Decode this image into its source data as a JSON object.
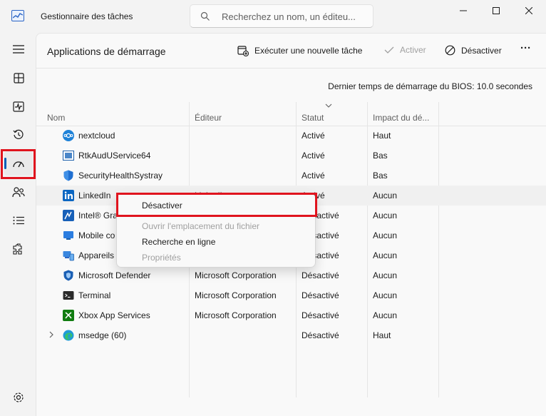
{
  "window": {
    "title": "Gestionnaire des tâches",
    "search_placeholder": "Recherchez un nom, un éditeu..."
  },
  "sidebar": {
    "items": [
      {
        "icon": "hamburger-icon"
      },
      {
        "icon": "processes-icon"
      },
      {
        "icon": "performance-icon"
      },
      {
        "icon": "app-history-icon"
      },
      {
        "icon": "startup-apps-icon",
        "active": true
      },
      {
        "icon": "users-icon"
      },
      {
        "icon": "details-icon"
      },
      {
        "icon": "services-icon"
      },
      {
        "icon": "settings-icon"
      }
    ]
  },
  "header": {
    "page_title": "Applications de démarrage",
    "run_task": "Exécuter une nouvelle tâche",
    "enable": "Activer",
    "disable": "Désactiver",
    "more": "···"
  },
  "bios_time": "Dernier temps de démarrage du BIOS: 10.0 secondes",
  "table": {
    "columns": [
      "Nom",
      "Éditeur",
      "Statut",
      "Impact du dé..."
    ],
    "rows": [
      {
        "name": "nextcloud",
        "publisher": "",
        "status": "Activé",
        "impact": "Haut",
        "icon": "nextcloud-icon"
      },
      {
        "name": "RtkAudUService64",
        "publisher": "",
        "status": "Activé",
        "impact": "Bas",
        "icon": "realtek-icon"
      },
      {
        "name": "SecurityHealthSystray",
        "publisher": "",
        "status": "Activé",
        "impact": "Bas",
        "icon": "shield-icon"
      },
      {
        "name": "LinkedIn",
        "publisher": "LinkedIn",
        "status": "Activé",
        "impact": "Aucun",
        "icon": "linkedin-icon"
      },
      {
        "name": "Intel® Gra",
        "publisher": "",
        "status": "Désactivé",
        "impact": "Aucun",
        "icon": "intel-graphics-icon"
      },
      {
        "name": "Mobile co",
        "publisher": "",
        "status": "Désactivé",
        "impact": "Aucun",
        "icon": "phone-link-icon"
      },
      {
        "name": "Appareils",
        "publisher": "",
        "status": "Désactivé",
        "impact": "Aucun",
        "icon": "devices-icon"
      },
      {
        "name": "Microsoft Defender",
        "publisher": "Microsoft Corporation",
        "status": "Désactivé",
        "impact": "Aucun",
        "icon": "defender-icon"
      },
      {
        "name": "Terminal",
        "publisher": "Microsoft Corporation",
        "status": "Désactivé",
        "impact": "Aucun",
        "icon": "terminal-icon"
      },
      {
        "name": "Xbox App Services",
        "publisher": "Microsoft Corporation",
        "status": "Désactivé",
        "impact": "Aucun",
        "icon": "xbox-icon"
      },
      {
        "name": "msedge (60)",
        "publisher": "",
        "status": "Désactivé",
        "impact": "Haut",
        "icon": "edge-icon",
        "expandable": true
      }
    ]
  },
  "context_menu": {
    "items": [
      {
        "label": "Désactiver",
        "enabled": true
      },
      {
        "label": "Ouvrir l'emplacement du fichier",
        "enabled": false
      },
      {
        "label": "Recherche en ligne",
        "enabled": true
      },
      {
        "label": "Propriétés",
        "enabled": false
      }
    ]
  },
  "colors": {
    "highlight": "#e0141e",
    "accent": "#005fb8"
  }
}
